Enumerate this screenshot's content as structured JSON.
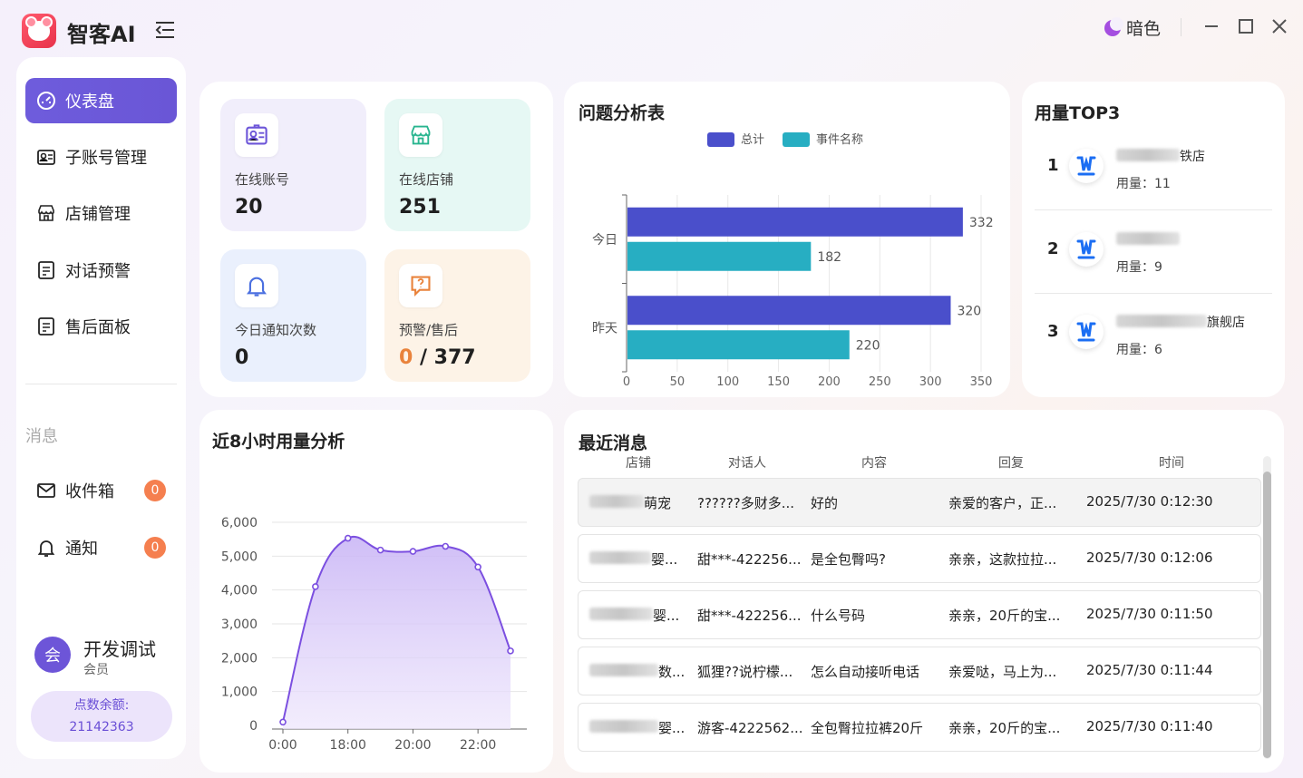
{
  "app": {
    "title": "智客AI",
    "theme_label": "暗色"
  },
  "nav": [
    {
      "label": "仪表盘",
      "icon": "dashboard-icon",
      "active": true
    },
    {
      "label": "子账号管理",
      "icon": "id-card-icon"
    },
    {
      "label": "店铺管理",
      "icon": "store-icon"
    },
    {
      "label": "对话预警",
      "icon": "document-icon"
    },
    {
      "label": "售后面板",
      "icon": "document-icon"
    }
  ],
  "messages_section": {
    "title": "消息",
    "items": [
      {
        "label": "收件箱",
        "icon": "mail-icon",
        "badge": "0"
      },
      {
        "label": "通知",
        "icon": "bell-icon",
        "badge": "0"
      }
    ]
  },
  "user": {
    "avatar": "会",
    "name": "开发调试",
    "role": "会员",
    "points_label": "点数余额:",
    "points": "21142363"
  },
  "stats": [
    {
      "label": "在线账号",
      "value": "20",
      "icon": "id-card-icon",
      "bg": "#f1eefb",
      "color": "#6c55d8"
    },
    {
      "label": "在线店铺",
      "value": "251",
      "icon": "store-icon",
      "bg": "#e6f8f4",
      "color": "#28b58f"
    },
    {
      "label": "今日通知次数",
      "value": "0",
      "icon": "bell-icon",
      "bg": "#eaf0fd",
      "color": "#4a6fe0"
    },
    {
      "label": "预警/售后",
      "value_a": "0",
      "value_sep": " / ",
      "value_b": "377",
      "icon": "warning-icon",
      "bg": "#fdf3e7",
      "color": "#e9833c"
    }
  ],
  "issue_chart": {
    "title": "问题分析表",
    "chart_data": {
      "type": "bar",
      "orientation": "horizontal",
      "categories": [
        "今日",
        "昨天"
      ],
      "series": [
        {
          "name": "总计",
          "color": "#4a4fcb",
          "values": [
            332,
            320
          ]
        },
        {
          "name": "事件名称",
          "color": "#27aec2",
          "values": [
            182,
            220
          ]
        }
      ],
      "xlim": [
        0,
        350
      ],
      "xticks": [
        0,
        50,
        100,
        150,
        200,
        250,
        300,
        350
      ],
      "grid": true,
      "legend": "top-center"
    }
  },
  "top3": {
    "title": "用量TOP3",
    "usage_label": "用量：",
    "items": [
      {
        "rank": "1",
        "name_suffix": "铁店",
        "usage": "11"
      },
      {
        "rank": "2",
        "name_suffix": "",
        "usage": "9"
      },
      {
        "rank": "3",
        "name_suffix": "旗舰店",
        "usage": "6"
      }
    ]
  },
  "usage_chart": {
    "title": "近8小时用量分析",
    "chart_data": {
      "type": "area",
      "x": [
        0,
        1,
        2,
        3,
        4,
        5,
        6,
        7
      ],
      "values": [
        100,
        4100,
        5530,
        5180,
        5140,
        5290,
        4680,
        2200
      ],
      "xtick_labels": [
        {
          "x": 0,
          "label": "0:00"
        },
        {
          "x": 2,
          "label": "18:00"
        },
        {
          "x": 4,
          "label": "20:00"
        },
        {
          "x": 6,
          "label": "22:00"
        }
      ],
      "ylim": [
        0,
        6000
      ],
      "yticks": [
        "0",
        "1,000",
        "2,000",
        "3,000",
        "4,000",
        "5,000",
        "6,000"
      ],
      "line_color": "#7b4fe0",
      "grid": true
    }
  },
  "recent": {
    "title": "最近消息",
    "columns": [
      "店铺",
      "对话人",
      "内容",
      "回复",
      "时间"
    ],
    "rows": [
      {
        "shop": "萌宠",
        "person": "??????多财多...",
        "content": "好的",
        "reply": "亲爱的客户，正...",
        "time": "2025/7/30 0:12:30"
      },
      {
        "shop": "婴...",
        "person": "甜***-422256...",
        "content": "是全包臀吗?",
        "reply": "亲亲，这款拉拉...",
        "time": "2025/7/30 0:12:06"
      },
      {
        "shop": "婴...",
        "person": "甜***-422256...",
        "content": "什么号码",
        "reply": "亲亲，20斤的宝...",
        "time": "2025/7/30 0:11:50"
      },
      {
        "shop": "数...",
        "person": "狐狸??说柠檬...",
        "content": "怎么自动接听电话",
        "reply": "亲爱哒，马上为...",
        "time": "2025/7/30 0:11:44"
      },
      {
        "shop": "婴...",
        "person": "游客-4222562...",
        "content": "全包臀拉拉裤20斤",
        "reply": "亲亲，20斤的宝...",
        "time": "2025/7/30 0:11:40"
      }
    ]
  }
}
